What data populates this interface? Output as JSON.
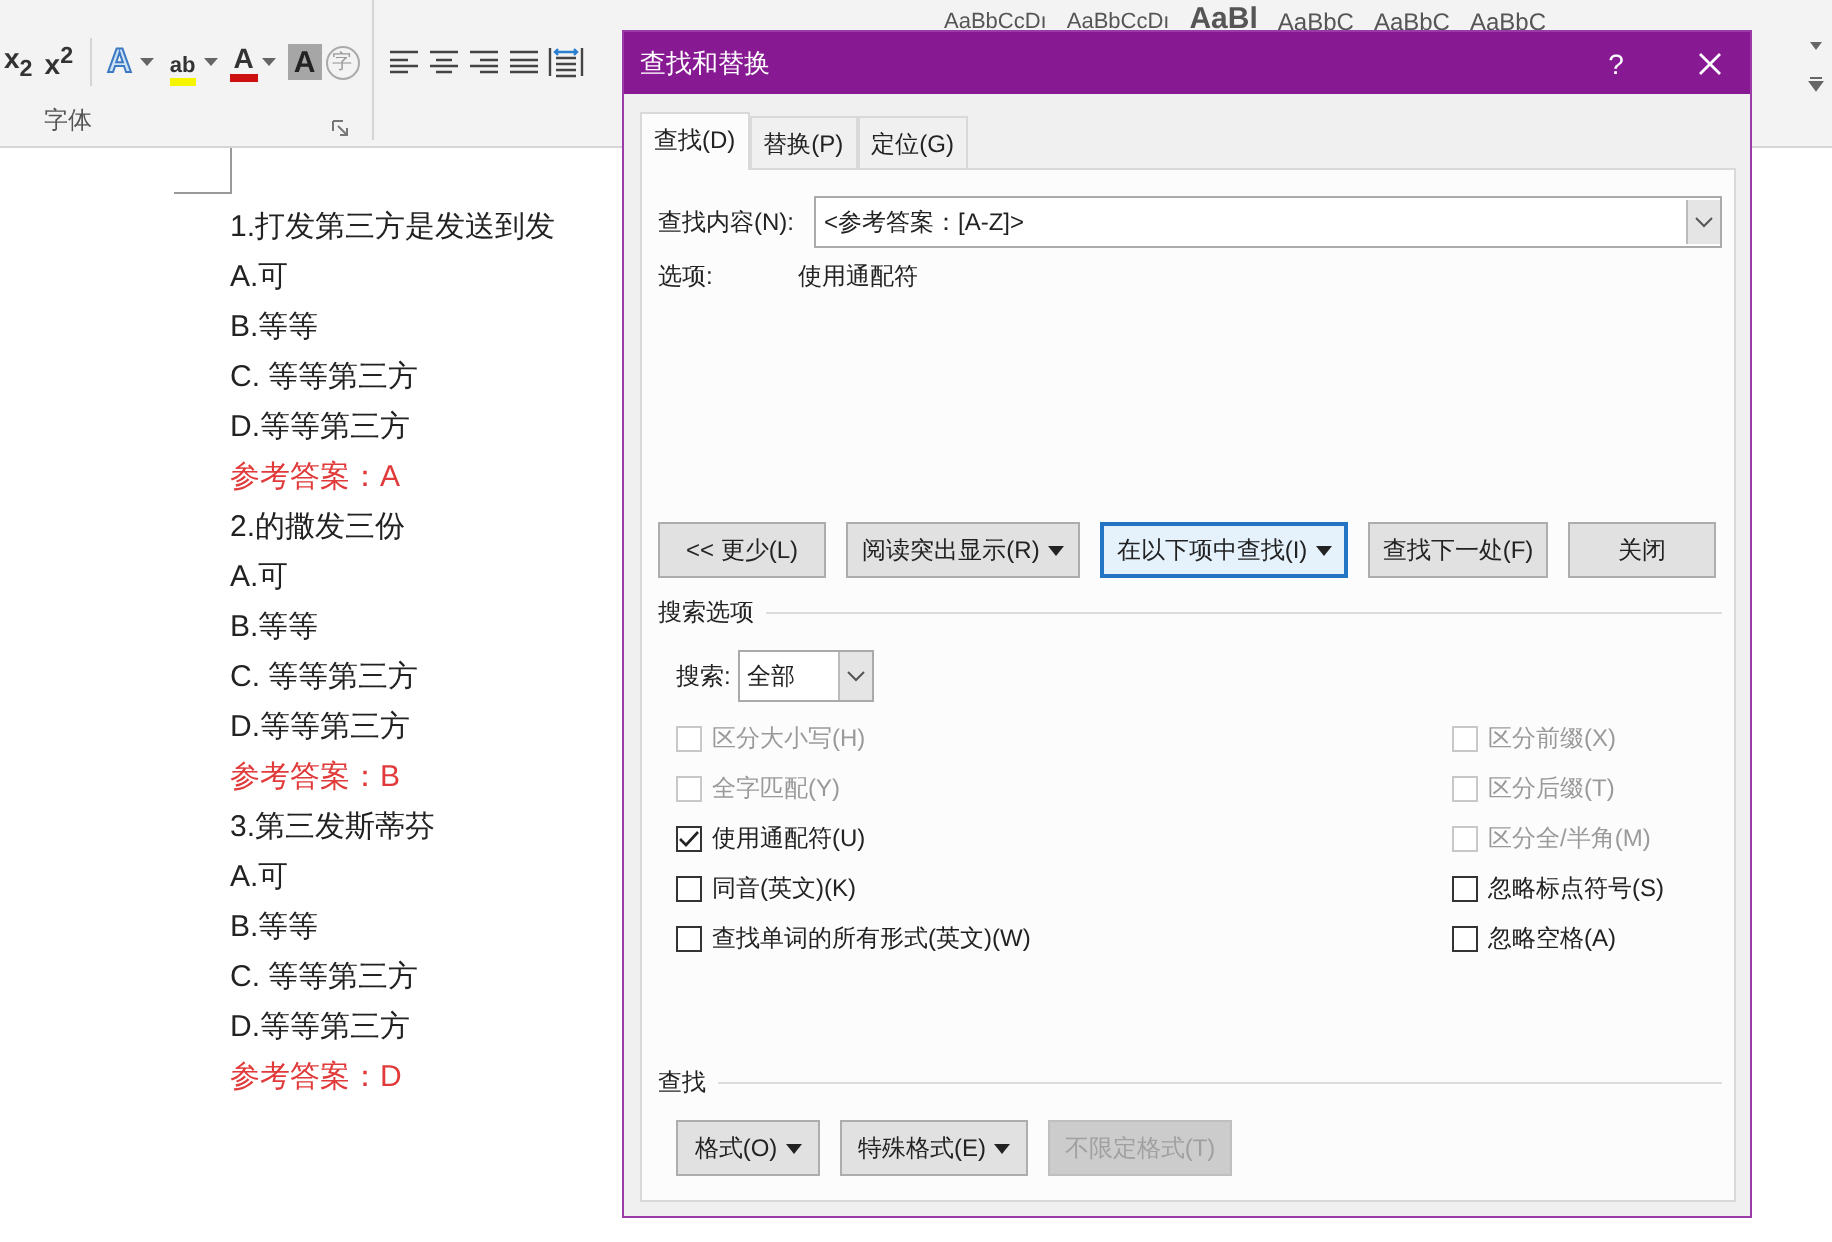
{
  "ribbon": {
    "styles": [
      "AaBbCcDı",
      "AaBbCcDı",
      "AaBl",
      "AaBbC",
      "AaBbC",
      "AaBbC"
    ],
    "font_buttons": [
      {
        "kind": "subscript",
        "text": "x$_{2}$"
      },
      {
        "kind": "superscript",
        "text": "x$^{2}$"
      },
      {
        "kind": "effect",
        "text": "A"
      },
      {
        "kind": "highlight",
        "text": "ab"
      },
      {
        "kind": "fontcolor",
        "text": "A"
      },
      {
        "kind": "shade",
        "text": "A"
      },
      {
        "kind": "enclose",
        "text": "字"
      }
    ],
    "group_label": "字体"
  },
  "document": {
    "lines": [
      {
        "kind": "question",
        "text": "1.打发第三方是发送到发"
      },
      {
        "kind": "option",
        "text": "A.可"
      },
      {
        "kind": "option",
        "text": "B.等等"
      },
      {
        "kind": "option",
        "text": "C.  等等第三方"
      },
      {
        "kind": "option",
        "text": "D.等等第三方"
      },
      {
        "kind": "answer",
        "text": "参考答案：A"
      },
      {
        "kind": "question",
        "text": "2.的撒发三份"
      },
      {
        "kind": "option",
        "text": "A.可"
      },
      {
        "kind": "option",
        "text": "B.等等"
      },
      {
        "kind": "option",
        "text": "C.  等等第三方"
      },
      {
        "kind": "option",
        "text": "D.等等第三方"
      },
      {
        "kind": "answer",
        "text": "参考答案：B"
      },
      {
        "kind": "question",
        "text": "3.第三发斯蒂芬"
      },
      {
        "kind": "option",
        "text": "A.可"
      },
      {
        "kind": "option",
        "text": "B.等等"
      },
      {
        "kind": "option",
        "text": "C.  等等第三方"
      },
      {
        "kind": "option",
        "text": "D.等等第三方"
      },
      {
        "kind": "answer",
        "text": "参考答案：D"
      }
    ]
  },
  "dialog": {
    "title": "查找和替换",
    "help": "?",
    "tabs": [
      {
        "label": "查找(D)",
        "selected": true
      },
      {
        "label": "替换(P)",
        "selected": false
      },
      {
        "label": "定位(G)",
        "selected": false
      }
    ],
    "find_label": "查找内容(N):",
    "find_value": "<参考答案：[A-Z]>",
    "options_label": "选项:",
    "options_value": "使用通配符",
    "buttons": [
      {
        "label": "<< 更少(L)",
        "dropdown": false,
        "focused": false
      },
      {
        "label": "阅读突出显示(R)",
        "dropdown": true,
        "focused": false
      },
      {
        "label": "在以下项中查找(I)",
        "dropdown": true,
        "focused": true
      },
      {
        "label": "查找下一处(F)",
        "dropdown": false,
        "focused": false
      },
      {
        "label": "关闭",
        "dropdown": false,
        "focused": false
      }
    ],
    "search_options_title": "搜索选项",
    "search_label": "搜索:",
    "search_value": "全部",
    "left_checks": [
      {
        "label": "区分大小写(H)",
        "checked": false,
        "disabled": true
      },
      {
        "label": "全字匹配(Y)",
        "checked": false,
        "disabled": true
      },
      {
        "label": "使用通配符(U)",
        "checked": true,
        "disabled": false
      },
      {
        "label": "同音(英文)(K)",
        "checked": false,
        "disabled": false
      },
      {
        "label": "查找单词的所有形式(英文)(W)",
        "checked": false,
        "disabled": false
      }
    ],
    "right_checks": [
      {
        "label": "区分前缀(X)",
        "checked": false,
        "disabled": true
      },
      {
        "label": "区分后缀(T)",
        "checked": false,
        "disabled": true
      },
      {
        "label": "区分全/半角(M)",
        "checked": false,
        "disabled": true
      },
      {
        "label": "忽略标点符号(S)",
        "checked": false,
        "disabled": false
      },
      {
        "label": "忽略空格(A)",
        "checked": false,
        "disabled": false
      }
    ],
    "find_section": "查找",
    "bottom_buttons": [
      {
        "label": "格式(O)",
        "dropdown": true,
        "disabled": false
      },
      {
        "label": "特殊格式(E)",
        "dropdown": true,
        "disabled": false
      },
      {
        "label": "不限定格式(T)",
        "dropdown": false,
        "disabled": true
      }
    ]
  }
}
